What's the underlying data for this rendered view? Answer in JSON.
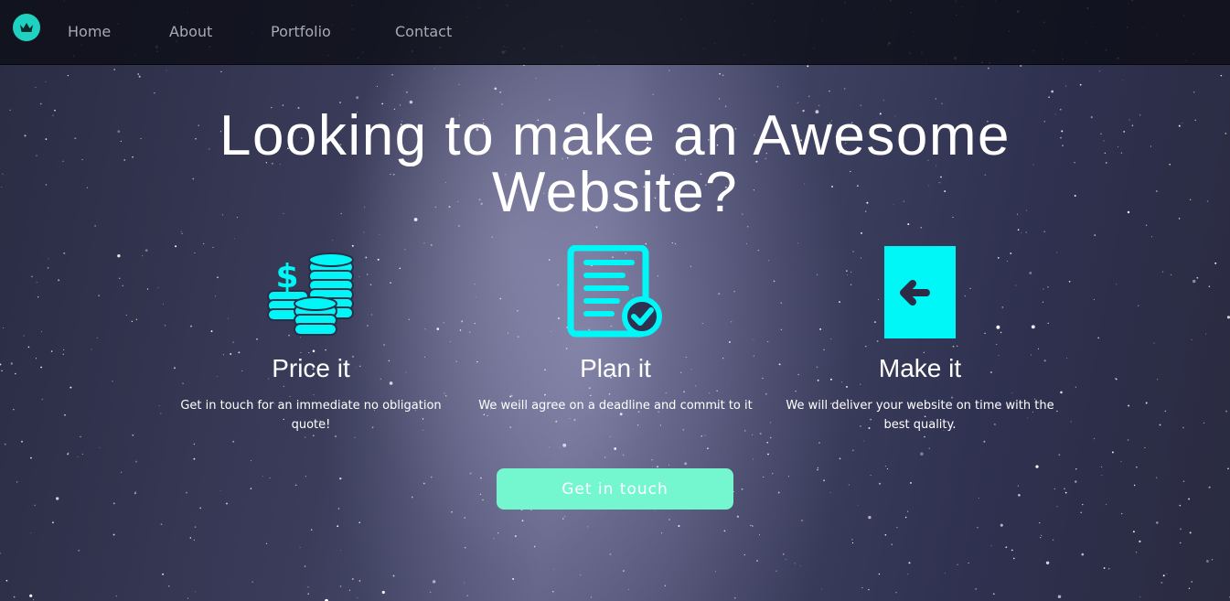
{
  "nav": {
    "links": [
      {
        "label": "Home"
      },
      {
        "label": "About"
      },
      {
        "label": "Portfolio"
      },
      {
        "label": "Contact"
      }
    ]
  },
  "hero": {
    "title": "Looking to make an Awesome Website?"
  },
  "features": [
    {
      "icon": "coins-dollar-icon",
      "title": "Price it",
      "text": "Get in touch for an immediate no obligation quote!"
    },
    {
      "icon": "document-check-icon",
      "title": "Plan it",
      "text": "We weill agree on a deadline and commit to it"
    },
    {
      "icon": "arrow-left-icon",
      "title": "Make it",
      "text": "We will deliver your website on time with the best quality."
    }
  ],
  "cta": {
    "label": "Get in touch"
  },
  "colors": {
    "accent": "#00f7f7",
    "button": "#74f7cf",
    "logo": "#1fd1c0",
    "navbar": "#0c0d16"
  }
}
